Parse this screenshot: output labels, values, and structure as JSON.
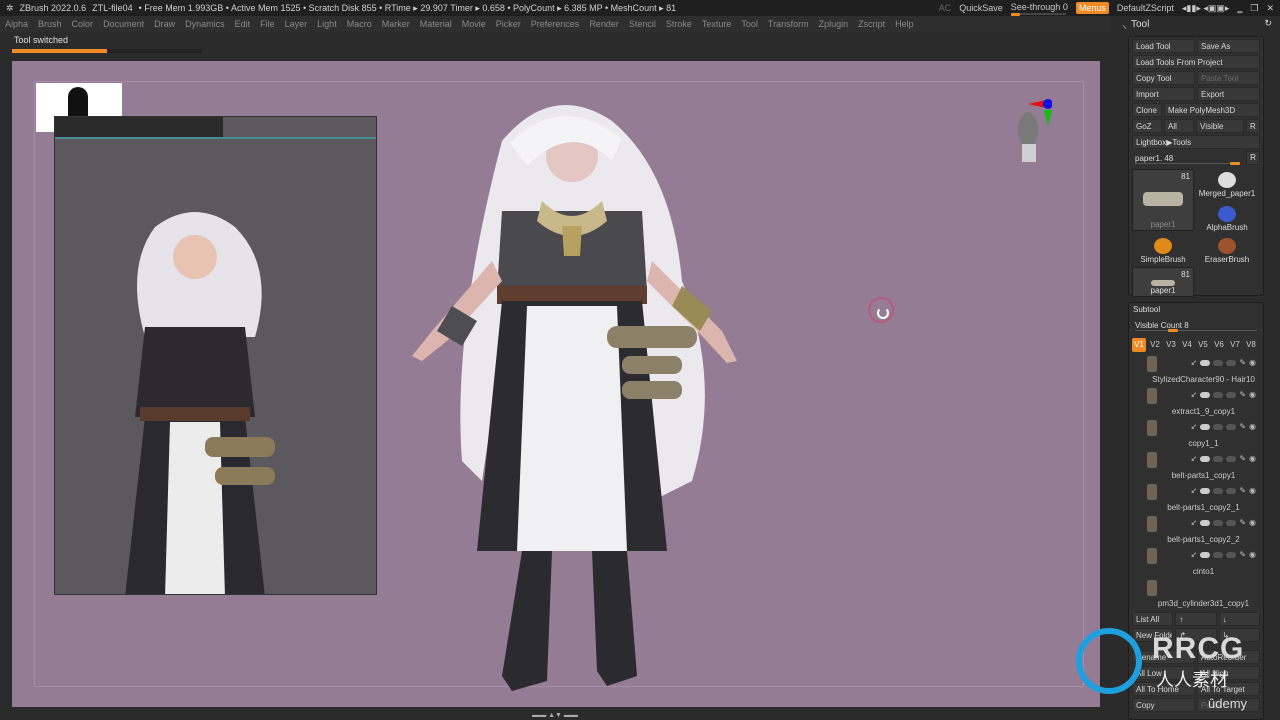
{
  "titlebar": {
    "app": "ZBrush 2022.0.6",
    "file": "ZTL-file04",
    "stats": "• Free Mem 1.993GB • Active Mem 1525 • Scratch Disk 855 • RTime ▸ 29.907 Timer ▸ 0.658 • PolyCount ▸ 6.385 MP • MeshCount ▸ 81",
    "ac": "AC",
    "quicksave": "QuickSave",
    "see_through_label": "See-through",
    "see_through_value": "0",
    "menus": "Menus",
    "script": "DefaultZScript"
  },
  "menubar": [
    "Alpha",
    "Brush",
    "Color",
    "Document",
    "Draw",
    "Dynamics",
    "Edit",
    "File",
    "Layer",
    "Light",
    "Macro",
    "Marker",
    "Material",
    "Movie",
    "Picker",
    "Preferences",
    "Render",
    "Stencil",
    "Stroke",
    "Texture",
    "Tool",
    "Transform",
    "Zplugin",
    "Zscript",
    "Help"
  ],
  "notice": {
    "text": "Tool switched",
    "progress_percent": 50
  },
  "tool_panel": {
    "title": "Tool",
    "buttons": {
      "load_tool": "Load Tool",
      "save_as": "Save As",
      "load_from_project": "Load Tools From Project",
      "copy_tool": "Copy Tool",
      "paste_tool": "Paste Tool",
      "import": "Import",
      "export": "Export",
      "clone": "Clone",
      "make_polymesh": "Make PolyMesh3D",
      "goz": "GoZ",
      "all": "All",
      "visible": "Visible",
      "r": "R",
      "lightbox": "Lightbox▶Tools"
    },
    "current_tool_slider": {
      "label": "paper1. 48",
      "r": "R",
      "value_fraction": 0.95
    },
    "tools": [
      {
        "label": "paper1",
        "count": "81",
        "icon": "paper-mesh-icon"
      },
      {
        "label": "Merged_paper1",
        "icon": "merged-mesh-icon"
      },
      {
        "label": "AlphaBrush",
        "icon": "alpha-brush-icon"
      },
      {
        "label": "SimpleBrush",
        "icon": "simple-brush-icon"
      },
      {
        "label": "EraserBrush",
        "icon": "eraser-brush-icon"
      },
      {
        "label": "paper1",
        "count": "81",
        "icon": "paper-mesh-icon"
      }
    ]
  },
  "subtool": {
    "title": "Subtool",
    "visible_count_label": "Visible Count 8",
    "visible_count_value": 8,
    "vtabs": [
      "V1",
      "V2",
      "V3",
      "V4",
      "V5",
      "V6",
      "V7",
      "V8"
    ],
    "active_vtab": "V1",
    "items": [
      {
        "name": "StylizedCharacter90 - Hair10"
      },
      {
        "name": "extract1_9_copy1"
      },
      {
        "name": "copy1_1"
      },
      {
        "name": "belt-parts1_copy1"
      },
      {
        "name": "belt-parts1_copy2_1"
      },
      {
        "name": "belt-parts1_copy2_2"
      },
      {
        "name": "cinto1"
      },
      {
        "name": "pm3d_cylinder3d1_copy1"
      }
    ],
    "list_all": "List All",
    "new_folder": "New Folder",
    "rename": "Rename",
    "auto_reorder": "AutoReorder",
    "all_low": "All Low",
    "all_high": "All High",
    "all_to_home": "All To Home",
    "all_to_target": "All To Target",
    "copy": "Copy",
    "paste": "Paste"
  },
  "watermark": {
    "brand": "RRCG",
    "cn": "人人素材",
    "udemy": "ûdemy"
  }
}
